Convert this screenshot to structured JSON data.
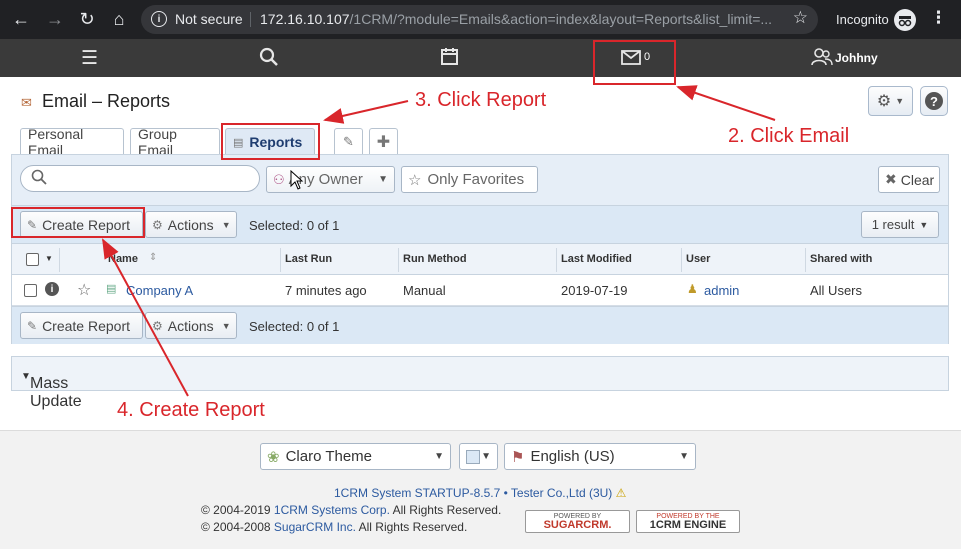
{
  "browser": {
    "security": "Not secure",
    "url_host": "172.16.10.107",
    "url_path": "/1CRM/?module=Emails&action=index&layout=Reports&list_limit=...",
    "profile": "Incognito"
  },
  "appbar": {
    "mail_count": "0",
    "user": "Johhny"
  },
  "header": {
    "title": "Email – Reports"
  },
  "tabs": [
    {
      "label": "Personal Email"
    },
    {
      "label": "Group Email"
    },
    {
      "label": "Reports"
    }
  ],
  "filters": {
    "search_placeholder": "",
    "owner": "Any Owner",
    "favorites": "Only Favorites",
    "clear": "Clear"
  },
  "toolbar": {
    "create_report": "Create Report",
    "actions": "Actions",
    "selected": "Selected: 0 of 1",
    "results": "1 result"
  },
  "table": {
    "columns": [
      "Name",
      "Last Run",
      "Run Method",
      "Last Modified",
      "User",
      "Shared with"
    ],
    "rows": [
      {
        "name": "Company A",
        "last_run": "7 minutes ago",
        "run_method": "Manual",
        "last_modified": "2019-07-19",
        "user": "admin",
        "shared_with": "All Users"
      }
    ]
  },
  "mass_update": "Mass Update",
  "footer": {
    "theme": "Claro Theme",
    "language": "English (US)",
    "system_line": "1CRM System STARTUP-8.5.7 • Tester Co.,Ltd (3U)",
    "copyright1_prefix": "© 2004-2019 ",
    "copyright1_link": "1CRM Systems Corp.",
    "copyright1_suffix": " All Rights Reserved.",
    "copyright2_prefix": "© 2004-2008 ",
    "copyright2_link": "SugarCRM Inc.",
    "copyright2_suffix": " All Rights Reserved.",
    "logo1_top": "POWERED BY",
    "logo1_bottom": "SUGARCRM.",
    "logo2_top": "POWERED BY THE",
    "logo2_bottom": "1CRM ENGINE"
  },
  "annotations": {
    "step2": "2. Click Email",
    "step3": "3. Click Report",
    "step4": "4. Create Report"
  },
  "colors": {
    "annotation": "#d9262b",
    "link": "#2c5aa0",
    "appbar": "#3a3a3a"
  }
}
